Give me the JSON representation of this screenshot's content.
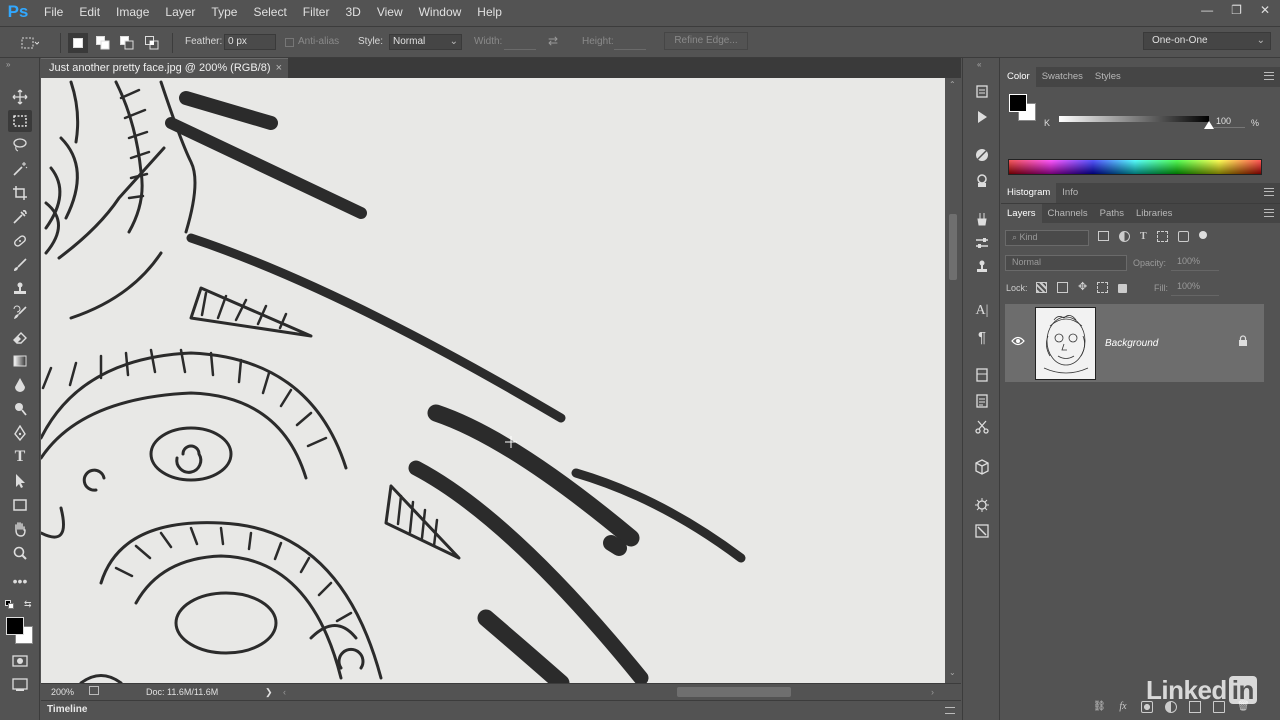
{
  "app": {
    "logo": "Ps"
  },
  "menu": [
    "File",
    "Edit",
    "Image",
    "Layer",
    "Type",
    "Select",
    "Filter",
    "3D",
    "View",
    "Window",
    "Help"
  ],
  "window_controls": {
    "minimize": "—",
    "restore": "❐",
    "close": "✕"
  },
  "options": {
    "feather_label": "Feather:",
    "feather_value": "0 px",
    "antialias_label": "Anti-alias",
    "style_label": "Style:",
    "style_value": "Normal",
    "width_label": "Width:",
    "height_label": "Height:",
    "refine_edge": "Refine Edge...",
    "workspace": "One-on-One"
  },
  "document": {
    "tab_title": "Just another pretty face.jpg @ 200% (RGB/8)",
    "close": "×"
  },
  "status": {
    "zoom": "200%",
    "doc_info": "Doc: 11.6M/11.6M",
    "arrow": "❯"
  },
  "timeline_label": "Timeline",
  "color_panel": {
    "tabs": [
      "Color",
      "Swatches",
      "Styles"
    ],
    "active_tab": "Color",
    "channel_label": "K",
    "channel_value": "100",
    "percent": "%"
  },
  "histogram_panel": {
    "tabs": [
      "Histogram",
      "Info"
    ],
    "active_tab": "Histogram"
  },
  "layers_panel": {
    "tabs": [
      "Layers",
      "Channels",
      "Paths",
      "Libraries"
    ],
    "active_tab": "Layers",
    "filter_kind": "Kind",
    "blend_mode": "Normal",
    "opacity_label": "Opacity:",
    "opacity_value": "100%",
    "lock_label": "Lock:",
    "fill_label": "Fill:",
    "fill_value": "100%",
    "layers": [
      {
        "name": "Background",
        "visible": true,
        "locked": true
      }
    ]
  },
  "watermark": {
    "text": "Linked",
    "in": "in"
  },
  "colors": {
    "ui": "#535353",
    "dark": "#3c3c3c",
    "canvas": "#e8e8e6",
    "ink": "#2b2b2b",
    "ps_blue": "#31a8ff"
  }
}
